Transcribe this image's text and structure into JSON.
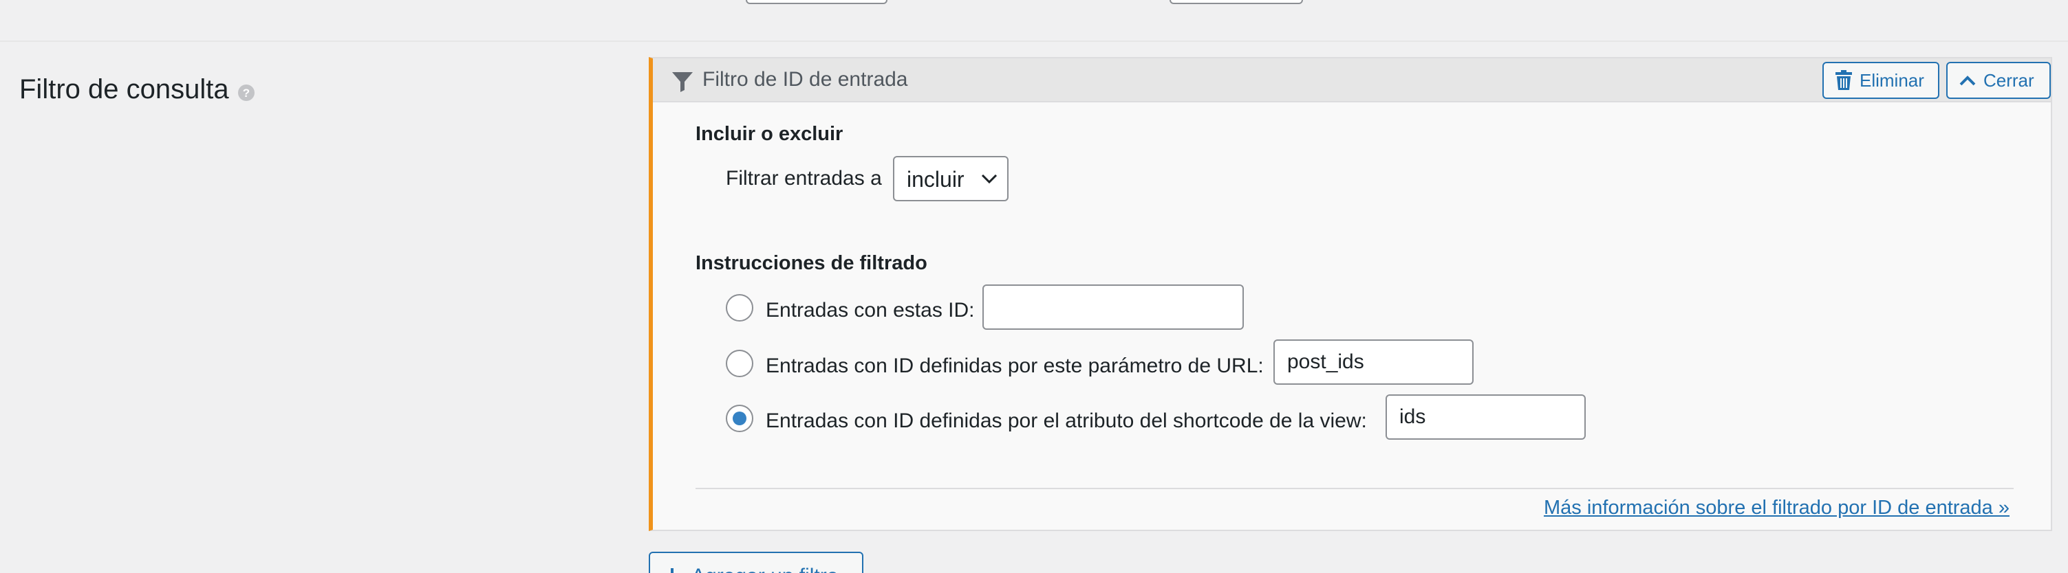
{
  "section": {
    "label": "Filtro de consulta"
  },
  "panel": {
    "title": "Filtro de ID de entrada",
    "delete_label": "Eliminar",
    "close_label": "Cerrar",
    "include_exclude": {
      "heading": "Incluir o excluir",
      "label": "Filtrar entradas a",
      "selected": "incluir"
    },
    "instructions": {
      "heading": "Instrucciones de filtrado",
      "options": [
        {
          "label": "Entradas con estas ID:",
          "value": "",
          "checked": false
        },
        {
          "label": "Entradas con ID definidas por este parámetro de URL:",
          "value": "post_ids",
          "checked": false
        },
        {
          "label": "Entradas con ID definidas por el atributo del shortcode de la view:",
          "value": "ids",
          "checked": true
        }
      ]
    },
    "more_link": "Más información sobre el filtrado por ID de entrada »"
  },
  "add_filter_label": "Agregar un filtro",
  "colors": {
    "accent": "#2271b1",
    "panel_border_left": "#f0931b",
    "radio_checked": "#3582c4"
  }
}
